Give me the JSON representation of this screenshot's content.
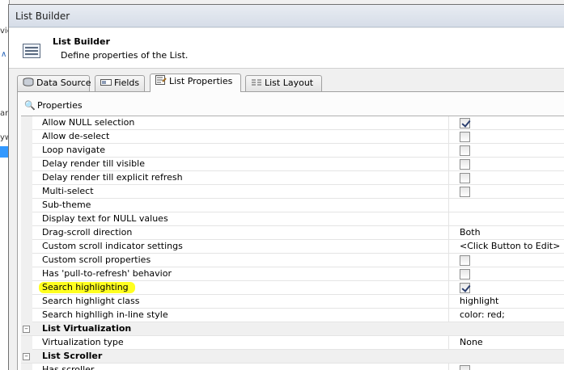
{
  "window": {
    "title": "List Builder"
  },
  "header": {
    "title": "List Builder",
    "subtitle": "Define properties of the List."
  },
  "tabs": [
    {
      "label": "Data Source",
      "icon": "database-icon",
      "active": false
    },
    {
      "label": "Fields",
      "icon": "fields-icon",
      "active": false
    },
    {
      "label": "List Properties",
      "icon": "properties-icon",
      "active": true
    },
    {
      "label": "List Layout",
      "icon": "layout-icon",
      "active": false
    }
  ],
  "panel": {
    "title": "Properties"
  },
  "background": {
    "fragments": [
      "vie",
      "ard",
      "yw"
    ]
  },
  "rows": [
    {
      "label": "Allow NULL selection",
      "type": "checkbox",
      "checked": true
    },
    {
      "label": "Allow de-select",
      "type": "checkbox",
      "checked": false
    },
    {
      "label": "Loop navigate",
      "type": "checkbox",
      "checked": false
    },
    {
      "label": "Delay render till visible",
      "type": "checkbox",
      "checked": false
    },
    {
      "label": "Delay render till explicit refresh",
      "type": "checkbox",
      "checked": false
    },
    {
      "label": "Multi-select",
      "type": "checkbox",
      "checked": false
    },
    {
      "label": "Sub-theme",
      "type": "text",
      "value": ""
    },
    {
      "label": "Display text for NULL values",
      "type": "text",
      "value": ""
    },
    {
      "label": "Drag-scroll direction",
      "type": "text",
      "value": "Both"
    },
    {
      "label": "Custom scroll indicator settings",
      "type": "text",
      "value": "<Click Button to Edit>"
    },
    {
      "label": "Custom scroll properties",
      "type": "checkbox",
      "checked": false
    },
    {
      "label": "Has 'pull-to-refresh' behavior",
      "type": "checkbox",
      "checked": false
    },
    {
      "label": "Search highlighting",
      "type": "checkbox",
      "checked": true,
      "highlighted": true
    },
    {
      "label": "Search highlight class",
      "type": "text",
      "value": "highlight"
    },
    {
      "label": "Search highlligh in-line style",
      "type": "text",
      "value": "color: red;"
    },
    {
      "section": "List Virtualization"
    },
    {
      "label": "Virtualization type",
      "type": "text",
      "value": "None"
    },
    {
      "section": "List Scroller"
    },
    {
      "label": "Has scroller",
      "type": "checkbox",
      "checked": false
    }
  ],
  "colors": {
    "highlight": "#ffff20",
    "selection": "#3399ff"
  }
}
